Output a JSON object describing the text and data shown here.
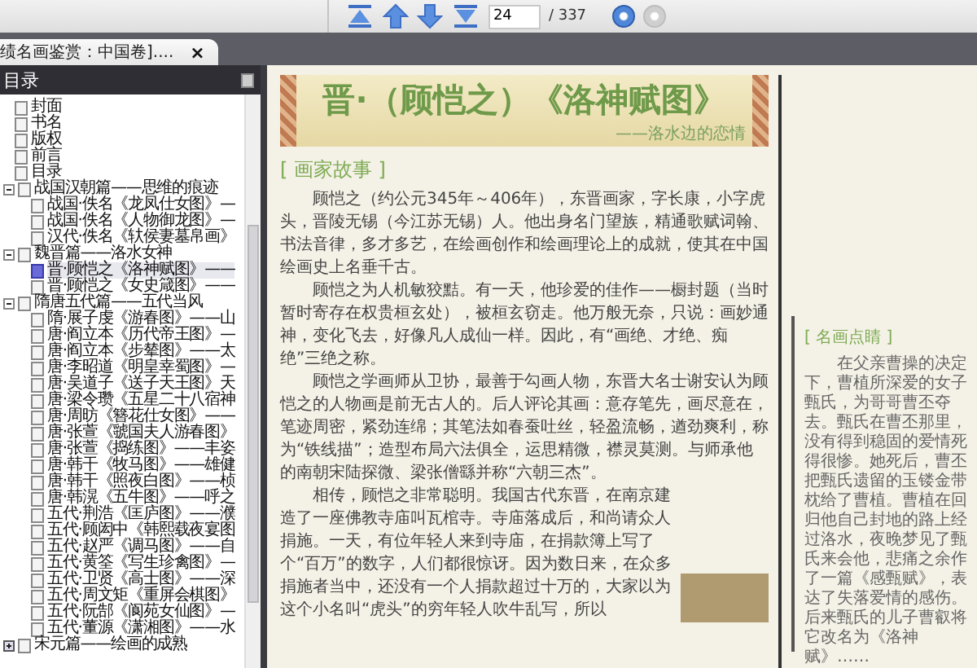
{
  "toolbar": {
    "page_field": {
      "value": "24"
    },
    "page_total": "/ 337",
    "back": {
      "disabled": false
    },
    "forward": {
      "disabled": true
    }
  },
  "tabs": [
    {
      "label": "绩名画鉴赏：中国卷]....",
      "selected": true,
      "close": "×"
    }
  ],
  "outline": {
    "title": "目录",
    "items": [
      {
        "label": "封面",
        "selected": false
      },
      {
        "label": "书名",
        "selected": false
      },
      {
        "label": "版权",
        "selected": false
      },
      {
        "label": "前言",
        "selected": false
      },
      {
        "label": "目录",
        "selected": false
      },
      {
        "label": "战国汉朝篇——思维的痕迹",
        "selected": false,
        "expanded": true,
        "children": [
          {
            "label": "战国·佚名《龙凤仕女图》—",
            "selected": false
          },
          {
            "label": "战国·佚名《人物御龙图》—",
            "selected": false
          },
          {
            "label": "汉代·佚名《轪侯妻墓帛画》",
            "selected": false
          }
        ]
      },
      {
        "label": "魏晋篇——洛水女神",
        "selected": false,
        "expanded": true,
        "children": [
          {
            "label": "晋·顾恺之《洛神赋图》——",
            "selected": true
          },
          {
            "label": "晋·顾恺之《女史箴图》——",
            "selected": false
          }
        ]
      },
      {
        "label": "隋唐五代篇——五代当风",
        "selected": false,
        "expanded": true,
        "children": [
          {
            "label": "隋·展子虔《游春图》——山",
            "selected": false
          },
          {
            "label": "唐·阎立本《历代帝王图》—",
            "selected": false
          },
          {
            "label": "唐·阎立本《步辇图》——太",
            "selected": false
          },
          {
            "label": "唐·李昭道《明皇幸蜀图》—",
            "selected": false
          },
          {
            "label": "唐·吴道子《送子天王图》天",
            "selected": false
          },
          {
            "label": "唐·梁令瓒《五星二十八宿神",
            "selected": false
          },
          {
            "label": "唐·周昉《簪花仕女图》——",
            "selected": false
          },
          {
            "label": "唐·张萱《虢国夫人游春图》",
            "selected": false
          },
          {
            "label": "唐·张萱《捣练图》——丰姿",
            "selected": false
          },
          {
            "label": "唐·韩干《牧马图》——雄健",
            "selected": false
          },
          {
            "label": "唐·韩干《照夜白图》——桢",
            "selected": false
          },
          {
            "label": "唐·韩滉《五牛图》——呼之",
            "selected": false
          },
          {
            "label": "五代·荆浩《匡庐图》——濮",
            "selected": false
          },
          {
            "label": "五代·顾闳中《韩熙载夜宴图",
            "selected": false
          },
          {
            "label": "五代·赵严《调马图》——自",
            "selected": false
          },
          {
            "label": "五代·黄筌《写生珍禽图》—",
            "selected": false
          },
          {
            "label": "五代·卫贤《高士图》——深",
            "selected": false
          },
          {
            "label": "五代·周文矩《重屏会棋图》",
            "selected": false
          },
          {
            "label": "五代·阮郜《阆苑女仙图》—",
            "selected": false
          },
          {
            "label": "五代·董源《潇湘图》——水",
            "selected": false
          }
        ]
      },
      {
        "label": "宋元篇——绘画的成熟",
        "selected": false,
        "expanded": false
      }
    ]
  },
  "page": {
    "banner": {
      "title": "晋·（顾恺之）《洛神赋图》",
      "subtitle": "——洛水边的恋情"
    },
    "section_heading": "[ 画家故事 ]",
    "paragraphs": [
      "顾恺之（约公元345年～406年），东晋画家，字长康，小字虎头，晋陵无锡（今江苏无锡）人。他出身名门望族，精通歌赋词翰、书法音律，多才多艺，在绘画创作和绘画理论上的成就，使其在中国绘画史上名垂千古。",
      "顾恺之为人机敏狡黠。有一天，他珍爱的佳作——橱封题（当时暂时寄存在权贵桓玄处），被桓玄窃走。他万般无奈，只说：画妙通神，变化飞去，好像凡人成仙一样。因此，有“画绝、才绝、痴绝”三绝之称。",
      "顾恺之学画师从卫协，最善于勾画人物，东晋大名士谢安认为顾恺之的人物画是前无古人的。后人评论其画：意存笔先，画尽意在，笔迹周密，紧劲连绵；其笔法如春蚕吐丝，轻盈流畅，遒劲爽利，称为“铁线描”；造型布局六法俱全，运思精微，襟灵莫测。与师承他的南朝宋陆探微、梁张僧繇并称“六朝三杰”。",
      "相传，顾恺之非常聪明。我国古代东晋，在南京建造了一座佛教寺庙叫瓦棺寺。寺庙落成后，和尚请众人捐施。一天，有位年轻人来到寺庙，在捐款簿上写了个“百万”的数字，人们都很惊讶。因为数日来，在众多捐施者当中，还没有一个人捐款超过十万的，大家以为这个小名叫“虎头”的穷年轻人吹牛乱写，所以"
    ],
    "side_note": {
      "heading": "[ 名画点睛 ]",
      "text": "在父亲曹操的决定下，曹植所深爱的女子甄氏，为哥哥曹丕夺去。甄氏在曹丕那里，没有得到稳固的爱情死得很惨。她死后，曹丕把甄氏遗留的玉镂金带枕给了曹植。曹植在回归他自己封地的路上经过洛水，夜晚梦见了甄氏来会他，悲痛之余作了一篇《感甄赋》，表达了失落爱情的感伤。后来甄氏的儿子曹叡将它改名为《洛神赋》……"
    }
  }
}
